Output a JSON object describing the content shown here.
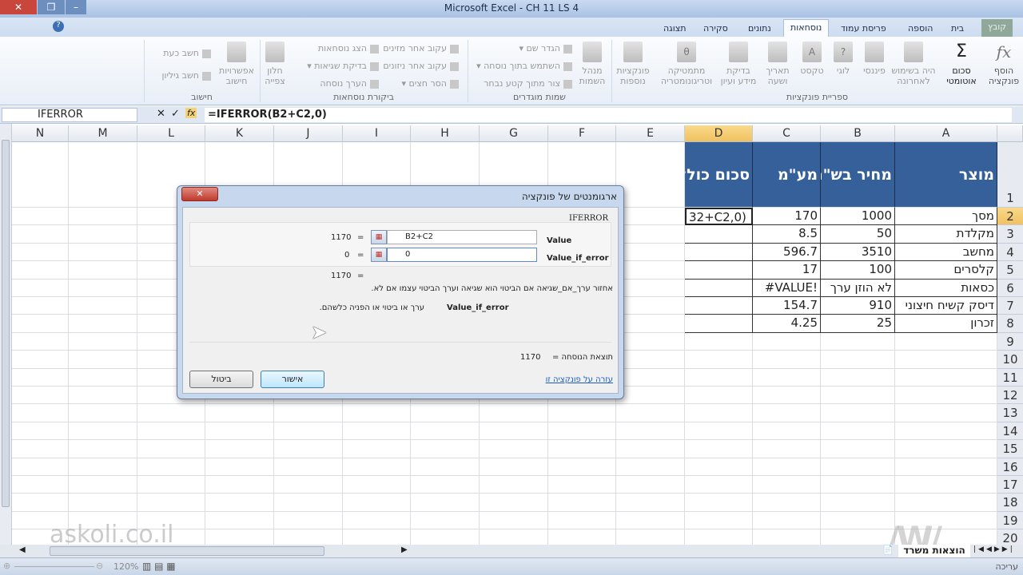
{
  "window": {
    "title": "Microsoft Excel - CH 11 LS 4"
  },
  "tabs": [
    {
      "label": "קובץ"
    },
    {
      "label": "בית"
    },
    {
      "label": "הוספה"
    },
    {
      "label": "פריסת עמוד"
    },
    {
      "label": "נוסחאות"
    },
    {
      "label": "נתונים"
    },
    {
      "label": "סקירה"
    },
    {
      "label": "תצוגה"
    }
  ],
  "ribbon": {
    "library": {
      "label": "ספריית פונקציות",
      "buttons": [
        "הוסף פונקציה",
        "סכום אוטומטי",
        "היה בשימוש לאחרונה",
        "פיננסי",
        "לוגי",
        "טקסט",
        "תאריך ושעה",
        "בדיקת מידע ועיון",
        "מתמטיקה וטריגונומטריה",
        "פונקציות נוספות"
      ]
    },
    "names": {
      "label": "שמות מוגדרים",
      "big": "מנהל השמות",
      "items": [
        "הגדר שם",
        "השתמש בתוך נוסחה",
        "צור מתוך קטע נבחר"
      ]
    },
    "audit": {
      "label": "ביקורת נוסחאות",
      "items": [
        "עקוב אחר מזינים",
        "עקוב אחר ניזונים",
        "הסר חצים",
        "הצג נוסחאות",
        "בדיקת שגיאות",
        "הערך נוסחה"
      ],
      "big": "חלון צפייה"
    },
    "calc": {
      "label": "חישוב",
      "big": "אפשרויות חישוב",
      "items": [
        "חשב כעת",
        "חשב גיליון"
      ]
    }
  },
  "formula_bar": {
    "name_box": "IFERROR",
    "formula": "=IFERROR(B2+C2,0)"
  },
  "columns": [
    "A",
    "B",
    "C",
    "D",
    "E",
    "F",
    "G",
    "H",
    "I",
    "J",
    "K",
    "L",
    "M",
    "N"
  ],
  "rows": [
    "1",
    "2",
    "3",
    "4",
    "5",
    "6",
    "7",
    "8",
    "9",
    "10",
    "11",
    "12",
    "13",
    "14",
    "15",
    "16",
    "17",
    "18",
    "19",
    "20"
  ],
  "table": {
    "headers": [
      "מוצר",
      "מחיר בש\"ח",
      "מע\"מ",
      "סכום כולל מע\"מ"
    ],
    "rows": [
      [
        "מסך",
        "1000",
        "170",
        "32+C2,0)"
      ],
      [
        "מקלדת",
        "50",
        "8.5",
        ""
      ],
      [
        "מחשב",
        "3510",
        "596.7",
        ""
      ],
      [
        "קלסרים",
        "100",
        "17",
        ""
      ],
      [
        "כסאות",
        "לא הוזן ערך",
        "#VALUE!",
        ""
      ],
      [
        "דיסק קשיח חיצוני",
        "910",
        "154.7",
        ""
      ],
      [
        "זכרון",
        "25",
        "4.25",
        ""
      ]
    ]
  },
  "dialog": {
    "title": "ארגומנטים של פונקציה",
    "function": "IFERROR",
    "args": [
      {
        "label": "Value",
        "value": "B2+C2",
        "result": "1170"
      },
      {
        "label": "Value_if_error",
        "value": "0",
        "result": "0"
      }
    ],
    "eq": "=",
    "overall_result": "1170",
    "description": "אחזור ערך_אם_שגיאה אם הביטוי הוא שגיאה וערך הביטוי עצמו אם לא.",
    "arg_help_name": "Value_if_error",
    "arg_help_text": "ערך או ביטוי או הפניה כלשהם.",
    "formula_result_label": "תוצאת הנוסחה =",
    "formula_result": "1170",
    "help_link": "עזרה על פונקציה זו",
    "ok": "אישור",
    "cancel": "ביטול"
  },
  "sheet_tab": "הוצאות משרד",
  "status": {
    "mode": "עריכה",
    "zoom": "120%"
  },
  "watermark": "askoli.co.il"
}
